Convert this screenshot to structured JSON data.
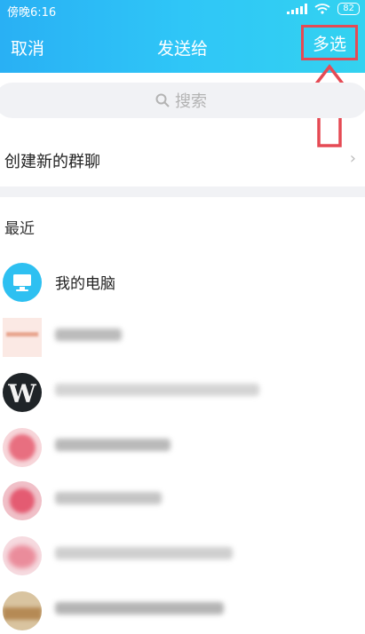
{
  "status_bar": {
    "time": "傍晚6:16",
    "battery": "82"
  },
  "nav": {
    "cancel": "取消",
    "title": "发送给",
    "multi_select": "多选"
  },
  "search": {
    "placeholder": "搜索"
  },
  "create_group": {
    "label": "创建新的群聊",
    "chevron": "›"
  },
  "recent_header": "最近",
  "contacts": [
    {
      "name": "我的电脑",
      "icon": "computer-icon"
    },
    {
      "name": "",
      "icon": "avatar"
    },
    {
      "name": "W",
      "icon": "avatar"
    },
    {
      "name": "",
      "icon": "avatar"
    },
    {
      "name": "",
      "icon": "avatar"
    },
    {
      "name": "",
      "icon": "avatar"
    },
    {
      "name": "",
      "icon": "avatar"
    }
  ],
  "colors": {
    "header_start": "#29b0f4",
    "header_end": "#33d2f0",
    "highlight": "#e54a54"
  }
}
